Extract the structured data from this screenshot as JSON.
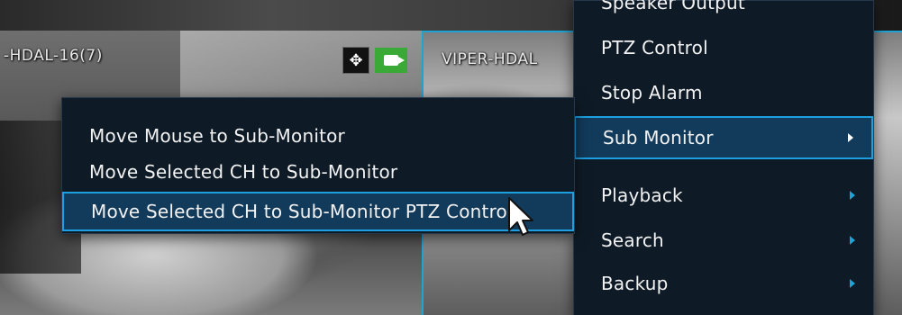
{
  "cameras": {
    "left_label": "-HDAL-16(7)",
    "right_label": "VIPER-HDAL"
  },
  "main_menu": {
    "items": [
      {
        "label": "Speaker Output",
        "has_submenu": false,
        "selected": false
      },
      {
        "label": "PTZ Control",
        "has_submenu": false,
        "selected": false
      },
      {
        "label": "Stop Alarm",
        "has_submenu": false,
        "selected": false
      },
      {
        "label": "Sub Monitor",
        "has_submenu": true,
        "selected": true
      },
      {
        "label": "Playback",
        "has_submenu": true,
        "selected": false
      },
      {
        "label": "Search",
        "has_submenu": true,
        "selected": false
      },
      {
        "label": "Backup",
        "has_submenu": true,
        "selected": false
      }
    ]
  },
  "sub_menu": {
    "items": [
      {
        "label": "Move Mouse to Sub-Monitor",
        "selected": false
      },
      {
        "label": "Move Selected CH to Sub-Monitor",
        "selected": false
      },
      {
        "label": "Move Selected CH to Sub-Monitor PTZ Control",
        "selected": true
      }
    ]
  },
  "icons": {
    "ptz": "move-arrows-icon",
    "record": "video-camera-icon",
    "cursor": "mouse-pointer-icon"
  },
  "colors": {
    "menu_bg": "#0e1b26",
    "highlight_border": "#1e9fe0",
    "highlight_bg": "#123a5a",
    "record_green": "#3aa935",
    "arrow_blue": "#1ea3d6"
  }
}
